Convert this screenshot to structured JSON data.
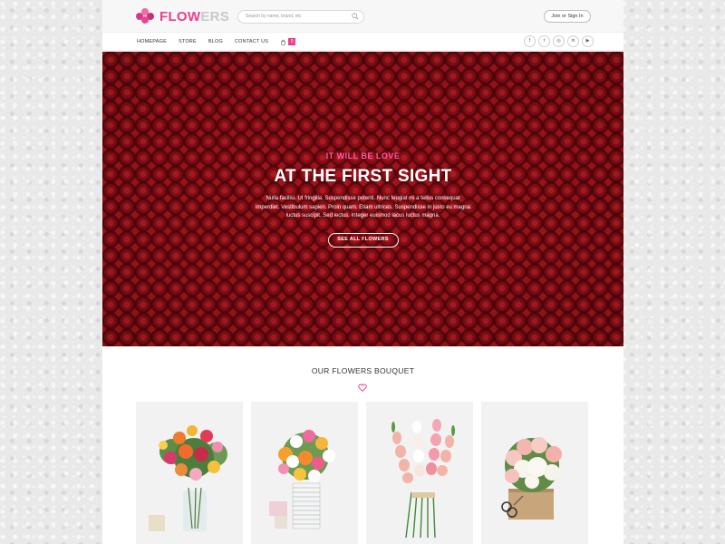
{
  "brand": {
    "name_part1": "FLOW",
    "name_part2": "ERS",
    "logo_icon": "flower-cluster-icon",
    "accent": "#ee3e8a"
  },
  "header": {
    "search_placeholder": "Search by name, brand, etc",
    "signin_label": "Join or Sign In"
  },
  "nav": {
    "items": [
      {
        "label": "HOMEPAGE"
      },
      {
        "label": "STORE"
      },
      {
        "label": "BLOG"
      },
      {
        "label": "CONTACT US"
      }
    ],
    "cart_count": "0"
  },
  "social": [
    {
      "icon": "facebook-icon",
      "glyph": "f"
    },
    {
      "icon": "twitter-icon",
      "glyph": "t"
    },
    {
      "icon": "instagram-icon",
      "glyph": "◎"
    },
    {
      "icon": "linkedin-icon",
      "glyph": "in"
    },
    {
      "icon": "youtube-icon",
      "glyph": "▶"
    }
  ],
  "hero": {
    "subtitle": "IT WILL BE LOVE",
    "title": "AT THE FIRST SIGHT",
    "text": "Nulla facilisi. Ut fringilla. Suspendisse potenti. Nunc feugiat mi a tellus consequat imperdiet. Vestibulum sapien. Proin quam. Etiam ultrices. Suspendisse in justo eu magna luctus suscipit. Sed lectus. Integer euismod lacus luctus magna.",
    "button_label": "SEE ALL FLOWERS"
  },
  "bouquets": {
    "title": "OUR FLOWERS BOUQUET",
    "icon": "heart-icon",
    "cards": [
      {
        "name": "mixed-bouquet-glass-vase"
      },
      {
        "name": "tulip-bouquet-white-vase"
      },
      {
        "name": "gladiolus-bouquet"
      },
      {
        "name": "rose-hydrangea-basket"
      }
    ]
  }
}
